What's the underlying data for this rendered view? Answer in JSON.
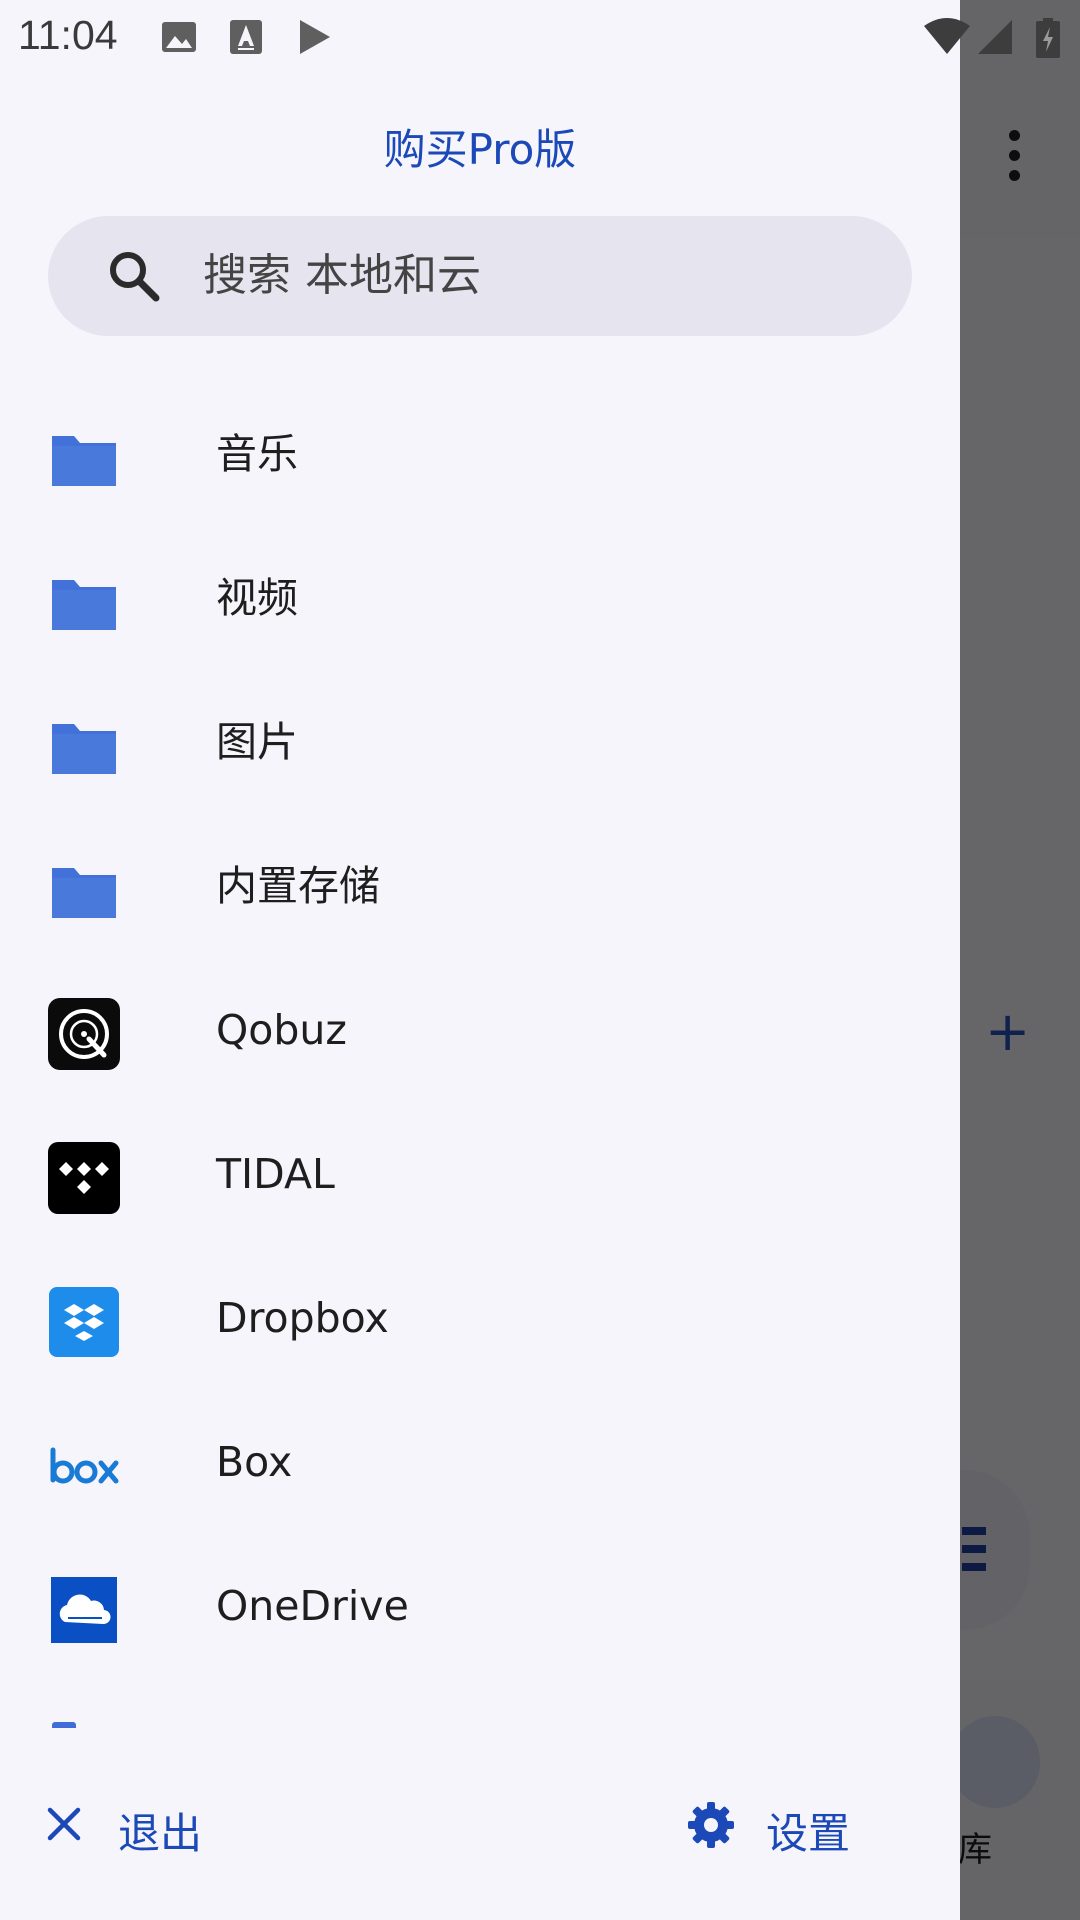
{
  "status_bar": {
    "time": "11:04",
    "icons": [
      "image-icon",
      "font-download-icon",
      "play-icon",
      "wifi-icon",
      "signal-icon",
      "battery-charging-icon"
    ]
  },
  "drawer": {
    "pro_link": "购买Pro版",
    "search": {
      "placeholder": "搜索 本地和云",
      "value": ""
    },
    "items": [
      {
        "label": "音乐",
        "icon": "folder-icon"
      },
      {
        "label": "视频",
        "icon": "folder-icon"
      },
      {
        "label": "图片",
        "icon": "folder-icon"
      },
      {
        "label": "内置存储",
        "icon": "folder-icon"
      },
      {
        "label": "Qobuz",
        "icon": "qobuz-logo-icon"
      },
      {
        "label": "TIDAL",
        "icon": "tidal-logo-icon"
      },
      {
        "label": "Dropbox",
        "icon": "dropbox-logo-icon"
      },
      {
        "label": "Box",
        "icon": "box-logo-icon"
      },
      {
        "label": "OneDrive",
        "icon": "onedrive-logo-icon"
      }
    ],
    "footer": {
      "exit_label": "退出",
      "settings_label": "设置"
    }
  },
  "background": {
    "nav_label_fragment": "库"
  },
  "colors": {
    "accent": "#1c49b8",
    "folder": "#4272d7",
    "drawer_bg": "#f6f5fb",
    "search_bg": "#e6e5ef"
  }
}
